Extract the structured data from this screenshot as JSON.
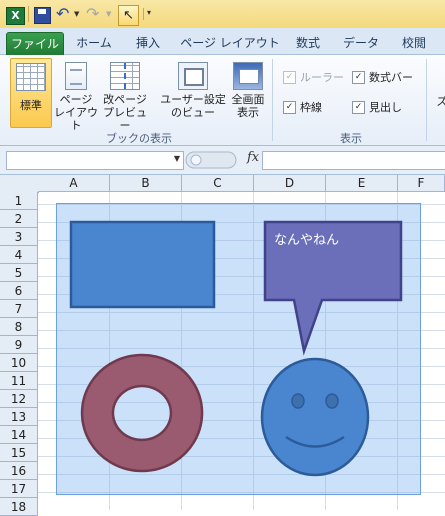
{
  "app": {
    "icon_letter": "X"
  },
  "tabs": [
    "ファイル",
    "ホーム",
    "挿入",
    "ページ レイアウト",
    "数式",
    "データ",
    "校閲"
  ],
  "ribbon": {
    "book_view": {
      "buttons": [
        {
          "line1": "標準",
          "line2": ""
        },
        {
          "line1": "ページ",
          "line2": "レイアウト"
        },
        {
          "line1": "改ページ",
          "line2": "プレビュー"
        },
        {
          "line1": "ユーザー設定",
          "line2": "のビュー"
        },
        {
          "line1": "全画面",
          "line2": "表示"
        }
      ],
      "label": "ブックの表示"
    },
    "show": {
      "label": "表示",
      "ruler": {
        "label": "ルーラー",
        "checked": true,
        "enabled": false
      },
      "formula_bar": {
        "label": "数式バー",
        "checked": true
      },
      "gridlines": {
        "label": "枠線",
        "checked": true
      },
      "headings": {
        "label": "見出し",
        "checked": true
      }
    },
    "cutoff_label": "ズ"
  },
  "formula_bar": {
    "name_value": "",
    "fx_label": "fx",
    "formula_value": ""
  },
  "columns": [
    "A",
    "B",
    "C",
    "D",
    "E",
    "F"
  ],
  "rows": [
    "1",
    "2",
    "3",
    "4",
    "5",
    "6",
    "7",
    "8",
    "9",
    "10",
    "11",
    "12",
    "13",
    "14",
    "15",
    "16",
    "17",
    "18"
  ],
  "shapes": {
    "callout_text": "なんやねん",
    "colors": {
      "rect": "#4a86cf",
      "callout": "#6b6eb8",
      "donut": "#9a5a70",
      "smiley": "#4a86cf"
    }
  }
}
